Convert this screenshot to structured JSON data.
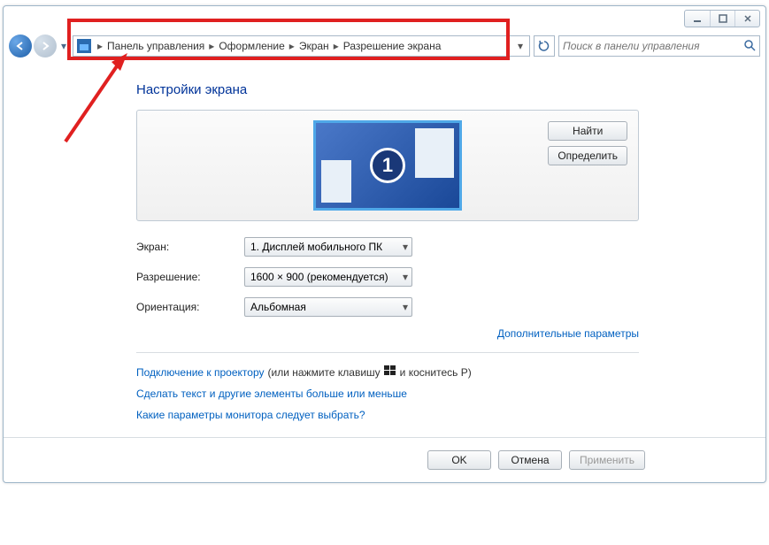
{
  "window": {
    "min_tooltip": "Свернуть",
    "max_tooltip": "Развернуть",
    "close_tooltip": "Закрыть"
  },
  "breadcrumb": {
    "items": [
      "Панель управления",
      "Оформление",
      "Экран",
      "Разрешение экрана"
    ]
  },
  "search": {
    "placeholder": "Поиск в панели управления"
  },
  "page": {
    "title": "Настройки экрана"
  },
  "monitorPanel": {
    "identifier": "1",
    "find_btn": "Найти",
    "detect_btn": "Определить"
  },
  "form": {
    "display_label": "Экран:",
    "display_value": "1. Дисплей мобильного ПК",
    "resolution_label": "Разрешение:",
    "resolution_value": "1600 × 900 (рекомендуется)",
    "orientation_label": "Ориентация:",
    "orientation_value": "Альбомная"
  },
  "links": {
    "advanced": "Дополнительные параметры",
    "projector_link": "Подключение к проектору",
    "projector_tail_a": "(или нажмите клавишу",
    "projector_tail_b": "и коснитесь P)",
    "textsize": "Сделать текст и другие элементы больше или меньше",
    "which_settings": "Какие параметры монитора следует выбрать?"
  },
  "buttons": {
    "ok": "OK",
    "cancel": "Отмена",
    "apply": "Применить"
  }
}
